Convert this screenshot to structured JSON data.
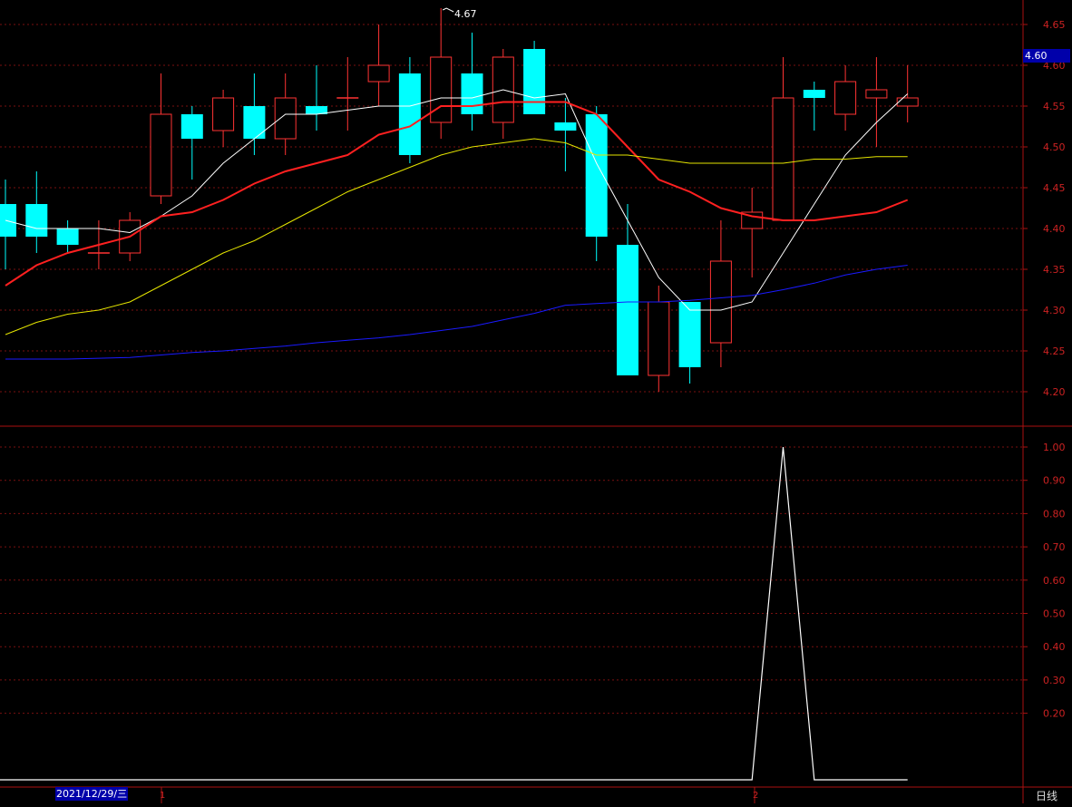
{
  "chart_data": [
    {
      "type": "candlestick",
      "title": "",
      "ylim": [
        4.15,
        4.67
      ],
      "y_ticks": [
        "4.65",
        "4.60",
        "4.55",
        "4.50",
        "4.45",
        "4.40",
        "4.35",
        "4.30",
        "4.25",
        "4.20"
      ],
      "current_price_label": "4.60",
      "peak_marker_label": "4.67",
      "grid": true,
      "colors": {
        "up": "#ff3333",
        "down": "#00ffff",
        "background": "#000000"
      },
      "candles": [
        {
          "o": 4.43,
          "h": 4.46,
          "l": 4.35,
          "c": 4.39
        },
        {
          "o": 4.43,
          "h": 4.47,
          "l": 4.37,
          "c": 4.39
        },
        {
          "o": 4.4,
          "h": 4.41,
          "l": 4.37,
          "c": 4.38
        },
        {
          "o": 4.37,
          "h": 4.41,
          "l": 4.35,
          "c": 4.37
        },
        {
          "o": 4.37,
          "h": 4.42,
          "l": 4.36,
          "c": 4.41
        },
        {
          "o": 4.44,
          "h": 4.59,
          "l": 4.43,
          "c": 4.54
        },
        {
          "o": 4.54,
          "h": 4.55,
          "l": 4.46,
          "c": 4.51
        },
        {
          "o": 4.52,
          "h": 4.57,
          "l": 4.5,
          "c": 4.56
        },
        {
          "o": 4.55,
          "h": 4.59,
          "l": 4.49,
          "c": 4.51
        },
        {
          "o": 4.51,
          "h": 4.59,
          "l": 4.49,
          "c": 4.56
        },
        {
          "o": 4.55,
          "h": 4.6,
          "l": 4.52,
          "c": 4.54
        },
        {
          "o": 4.56,
          "h": 4.61,
          "l": 4.52,
          "c": 4.56
        },
        {
          "o": 4.58,
          "h": 4.65,
          "l": 4.55,
          "c": 4.6
        },
        {
          "o": 4.59,
          "h": 4.61,
          "l": 4.48,
          "c": 4.49
        },
        {
          "o": 4.53,
          "h": 4.67,
          "l": 4.51,
          "c": 4.61
        },
        {
          "o": 4.59,
          "h": 4.64,
          "l": 4.52,
          "c": 4.54
        },
        {
          "o": 4.53,
          "h": 4.62,
          "l": 4.51,
          "c": 4.61
        },
        {
          "o": 4.62,
          "h": 4.63,
          "l": 4.54,
          "c": 4.54
        },
        {
          "o": 4.53,
          "h": 4.56,
          "l": 4.47,
          "c": 4.52
        },
        {
          "o": 4.54,
          "h": 4.55,
          "l": 4.36,
          "c": 4.39
        },
        {
          "o": 4.38,
          "h": 4.43,
          "l": 4.22,
          "c": 4.22
        },
        {
          "o": 4.22,
          "h": 4.33,
          "l": 4.2,
          "c": 4.31
        },
        {
          "o": 4.31,
          "h": 4.31,
          "l": 4.21,
          "c": 4.23
        },
        {
          "o": 4.26,
          "h": 4.41,
          "l": 4.23,
          "c": 4.36
        },
        {
          "o": 4.4,
          "h": 4.45,
          "l": 4.34,
          "c": 4.42
        },
        {
          "o": 4.41,
          "h": 4.61,
          "l": 4.41,
          "c": 4.56
        },
        {
          "o": 4.57,
          "h": 4.58,
          "l": 4.52,
          "c": 4.56
        },
        {
          "o": 4.54,
          "h": 4.6,
          "l": 4.52,
          "c": 4.58
        },
        {
          "o": 4.56,
          "h": 4.61,
          "l": 4.5,
          "c": 4.57
        },
        {
          "o": 4.55,
          "h": 4.6,
          "l": 4.53,
          "c": 4.56
        }
      ],
      "series": [
        {
          "color": "#ffffff",
          "values": [
            4.41,
            4.4,
            4.4,
            4.4,
            4.395,
            4.415,
            4.44,
            4.48,
            4.51,
            4.54,
            4.54,
            4.545,
            4.55,
            4.55,
            4.56,
            4.56,
            4.57,
            4.56,
            4.565,
            4.48,
            4.41,
            4.34,
            4.3,
            4.3,
            4.31,
            4.37,
            4.43,
            4.49,
            4.53,
            4.565
          ]
        },
        {
          "color": "#ff2020",
          "values": [
            4.33,
            4.355,
            4.37,
            4.38,
            4.39,
            4.415,
            4.42,
            4.435,
            4.455,
            4.47,
            4.48,
            4.49,
            4.515,
            4.525,
            4.55,
            4.55,
            4.555,
            4.555,
            4.555,
            4.54,
            4.5,
            4.46,
            4.445,
            4.425,
            4.415,
            4.41,
            4.41,
            4.415,
            4.42,
            4.435
          ]
        },
        {
          "color": "#e5e500",
          "values": [
            4.27,
            4.285,
            4.295,
            4.3,
            4.31,
            4.33,
            4.35,
            4.37,
            4.385,
            4.405,
            4.425,
            4.445,
            4.46,
            4.475,
            4.49,
            4.5,
            4.505,
            4.51,
            4.505,
            4.49,
            4.49,
            4.485,
            4.48,
            4.48,
            4.48,
            4.48,
            4.485,
            4.485,
            4.488,
            4.488
          ]
        },
        {
          "color": "#1a1aff",
          "values": [
            4.24,
            4.24,
            4.24,
            4.241,
            4.242,
            4.245,
            4.248,
            4.25,
            4.253,
            4.256,
            4.26,
            4.263,
            4.266,
            4.27,
            4.275,
            4.28,
            4.288,
            4.296,
            4.306,
            4.308,
            4.31,
            4.31,
            4.312,
            4.315,
            4.318,
            4.325,
            4.333,
            4.343,
            4.35,
            4.355
          ]
        }
      ]
    },
    {
      "type": "line",
      "title": "",
      "ylim": [
        0,
        1.0
      ],
      "y_ticks": [
        "1.00",
        "0.90",
        "0.80",
        "0.70",
        "0.60",
        "0.50",
        "0.40",
        "0.30",
        "0.20"
      ],
      "series": [
        {
          "color": "#ffffff",
          "values": [
            0,
            0,
            0,
            0,
            0,
            0,
            0,
            0,
            0,
            0,
            0,
            0,
            0,
            0,
            0,
            0,
            0,
            0,
            0,
            0,
            0,
            0,
            0,
            0,
            0,
            1.0,
            0,
            0,
            0,
            0
          ]
        }
      ]
    }
  ],
  "x_axis": {
    "date_label": "2021/12/29/三",
    "markers": [
      "1",
      "2"
    ]
  },
  "period_label": "日线"
}
